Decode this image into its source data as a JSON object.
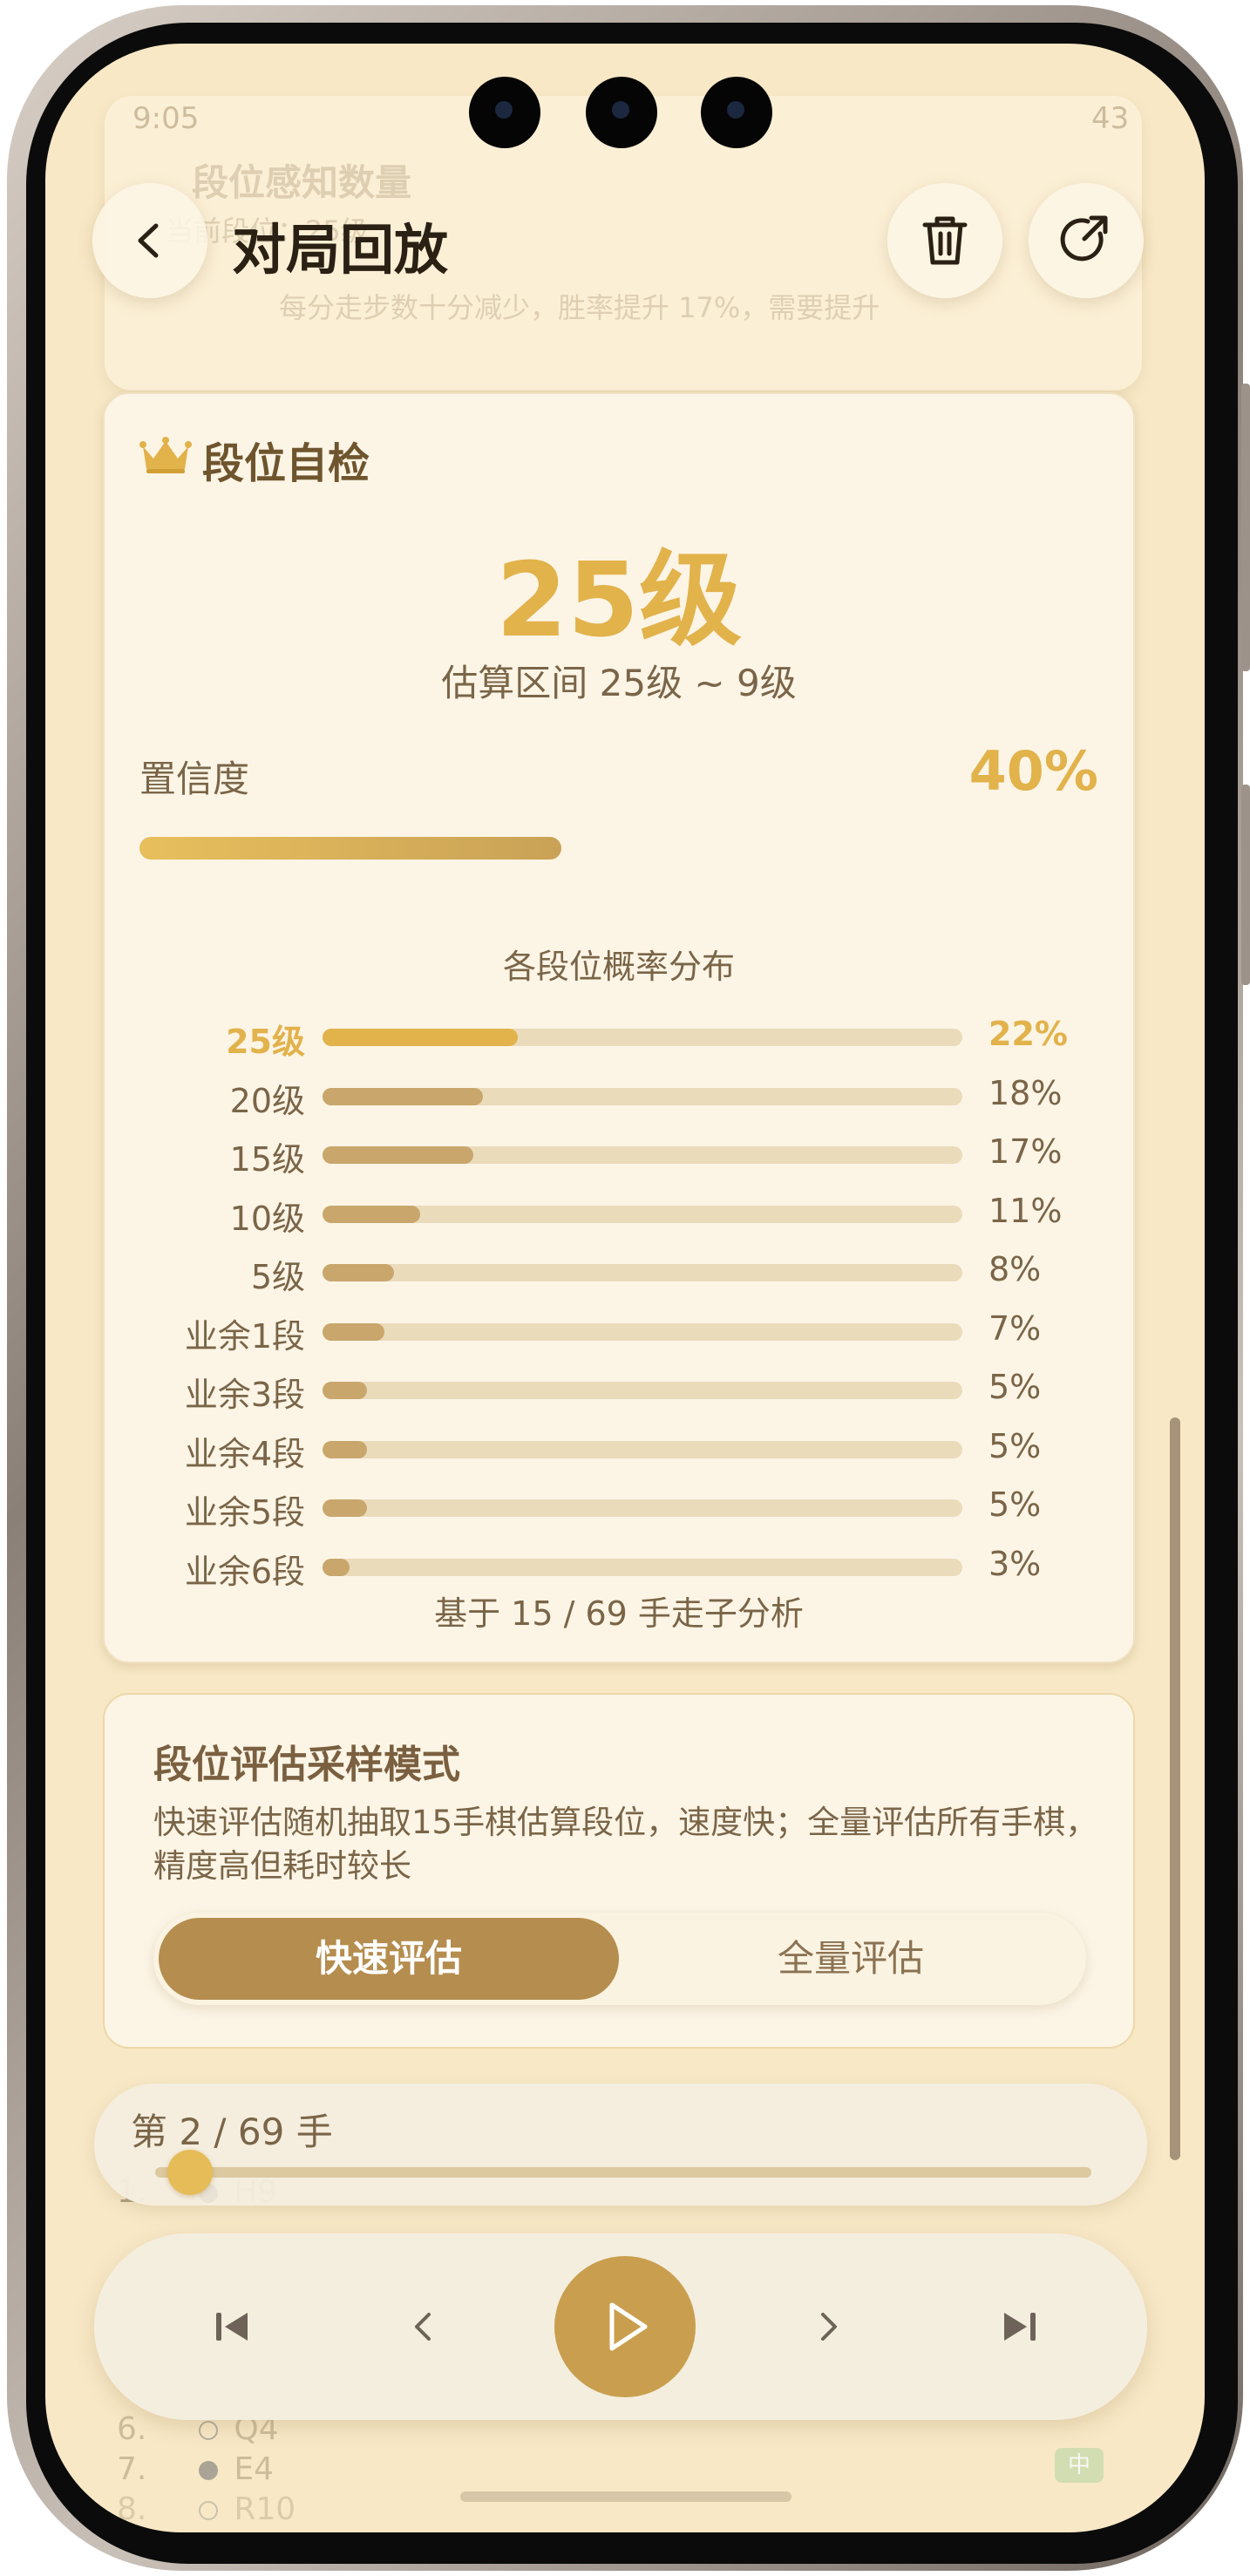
{
  "header": {
    "title": "对局回放",
    "back_icon": "chevron-left-icon",
    "delete_icon": "trash-icon",
    "share_icon": "share-icon"
  },
  "background": {
    "ghost_title": "段位感知数量",
    "ghost_sub": "当前段位：25级",
    "ghost_tip": "每分走步数十分减少，胜率提升 17%，需要提升"
  },
  "status_bar": {
    "time": "9:05",
    "battery": "43"
  },
  "rank_check": {
    "title": "段位自检",
    "level": "25级",
    "range": "估算区间 25级 ~ 9级",
    "confidence_label": "置信度",
    "confidence_value": "40%",
    "confidence_fraction": 0.4,
    "distribution_title": "各段位概率分布",
    "distribution": [
      {
        "label": "25级",
        "pct": "22%",
        "value": 22,
        "active": true
      },
      {
        "label": "20级",
        "pct": "18%",
        "value": 18
      },
      {
        "label": "15级",
        "pct": "17%",
        "value": 17
      },
      {
        "label": "10级",
        "pct": "11%",
        "value": 11
      },
      {
        "label": "5级",
        "pct": "8%",
        "value": 8
      },
      {
        "label": "业余1段",
        "pct": "7%",
        "value": 7
      },
      {
        "label": "业余3段",
        "pct": "5%",
        "value": 5
      },
      {
        "label": "业余4段",
        "pct": "5%",
        "value": 5
      },
      {
        "label": "业余5段",
        "pct": "5%",
        "value": 5
      },
      {
        "label": "业余6段",
        "pct": "3%",
        "value": 3
      }
    ],
    "footnote": "基于 15 / 69 手走子分析"
  },
  "sampling": {
    "title": "段位评估采样模式",
    "description": "快速评估随机抽取15手棋估算段位，速度快；全量评估所有手棋，精度高但耗时较长",
    "options": [
      "快速评估",
      "全量评估"
    ],
    "selected": "快速评估"
  },
  "playback": {
    "move_label": "第 2 / 69 手",
    "current_move": 2,
    "total_moves": 69,
    "moves_behind": [
      {
        "num": "1.",
        "coord": "H9"
      },
      {
        "num": "6.",
        "coord": "Q4"
      },
      {
        "num": "7.",
        "coord": "E4"
      },
      {
        "num": "8.",
        "coord": "R10"
      }
    ],
    "tag_behind": "中",
    "icons": [
      "skip-first-icon",
      "step-back-icon",
      "play-icon",
      "step-forward-icon",
      "skip-last-icon"
    ]
  },
  "colors": {
    "accent": "#e2b24b",
    "brand_brown": "#b58d4e",
    "background": "#f8e8c6",
    "card": "#fcf5e6"
  }
}
